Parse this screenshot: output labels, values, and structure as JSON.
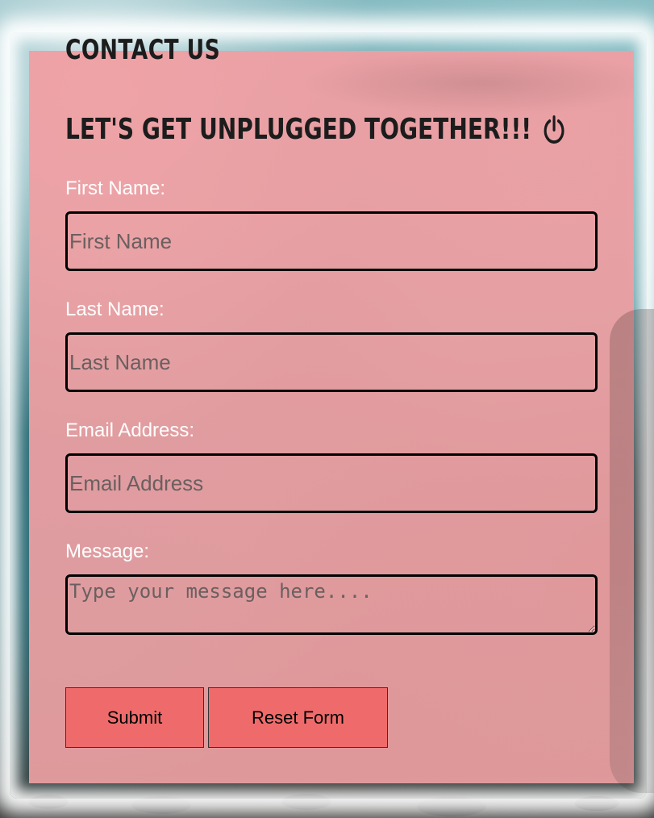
{
  "header": {
    "title": "CONTACT US",
    "subtitle": "LET'S GET UNPLUGGED TOGETHER!!!",
    "subtitle_icon": "power-icon"
  },
  "form": {
    "first_name": {
      "label": "First Name:",
      "placeholder": "First Name",
      "value": ""
    },
    "last_name": {
      "label": "Last Name:",
      "placeholder": "Last Name",
      "value": ""
    },
    "email": {
      "label": "Email Address:",
      "placeholder": "Email Address",
      "value": ""
    },
    "message": {
      "label": "Message:",
      "placeholder": "Type your message here....",
      "value": ""
    },
    "submit_label": "Submit",
    "reset_label": "Reset Form"
  },
  "colors": {
    "panel": "#f19ea2",
    "button": "#ef6b6b",
    "label_text": "#ffffff",
    "heading_text": "#1c1c1c"
  }
}
